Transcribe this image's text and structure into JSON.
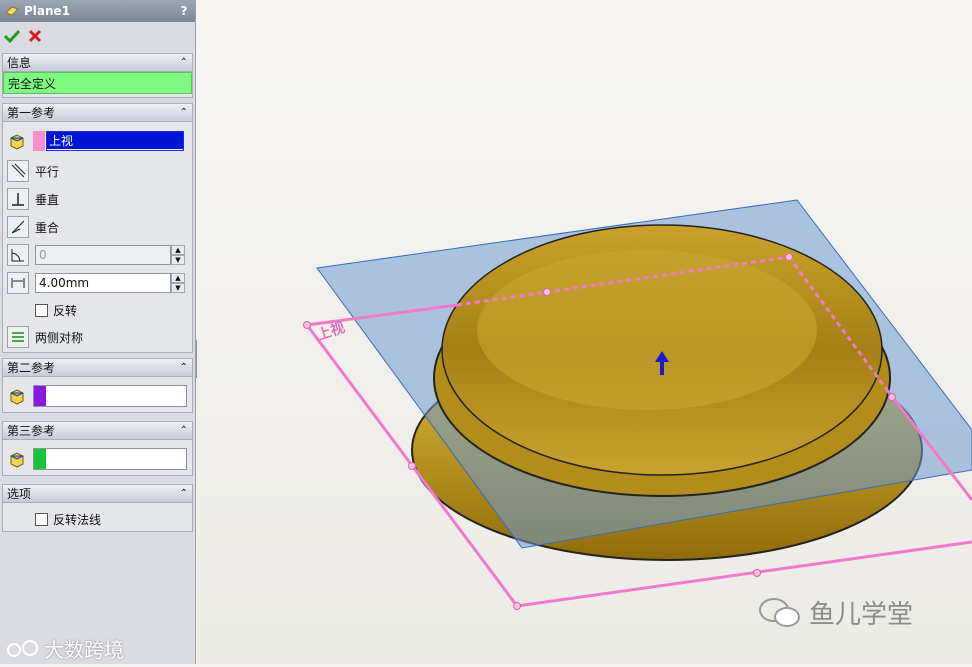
{
  "panel": {
    "title": "Plane1",
    "help": "?",
    "info_header": "信息",
    "status": "完全定义",
    "first_ref": {
      "header": "第一参考",
      "selection": "上视",
      "options": [
        "平行",
        "垂直",
        "重合"
      ],
      "angle_value": "0",
      "distance_value": "4.00mm",
      "flip_label": "反转",
      "symmetric_label": "两侧对称"
    },
    "second_ref": {
      "header": "第二参考"
    },
    "third_ref": {
      "header": "第三参考"
    },
    "options_section": {
      "header": "选项",
      "flip_normal_label": "反转法线"
    }
  },
  "viewport": {
    "plane_label": "上视"
  },
  "watermarks": {
    "left": "大数跨境",
    "right": "鱼儿学堂"
  },
  "colors": {
    "status_green": "#7dfa7f",
    "second_ref_swatch": "#8a16e8",
    "third_ref_swatch": "#18c43a",
    "first_ref_swatch": "#f58fd0",
    "plane_outline": "#f07acb"
  }
}
